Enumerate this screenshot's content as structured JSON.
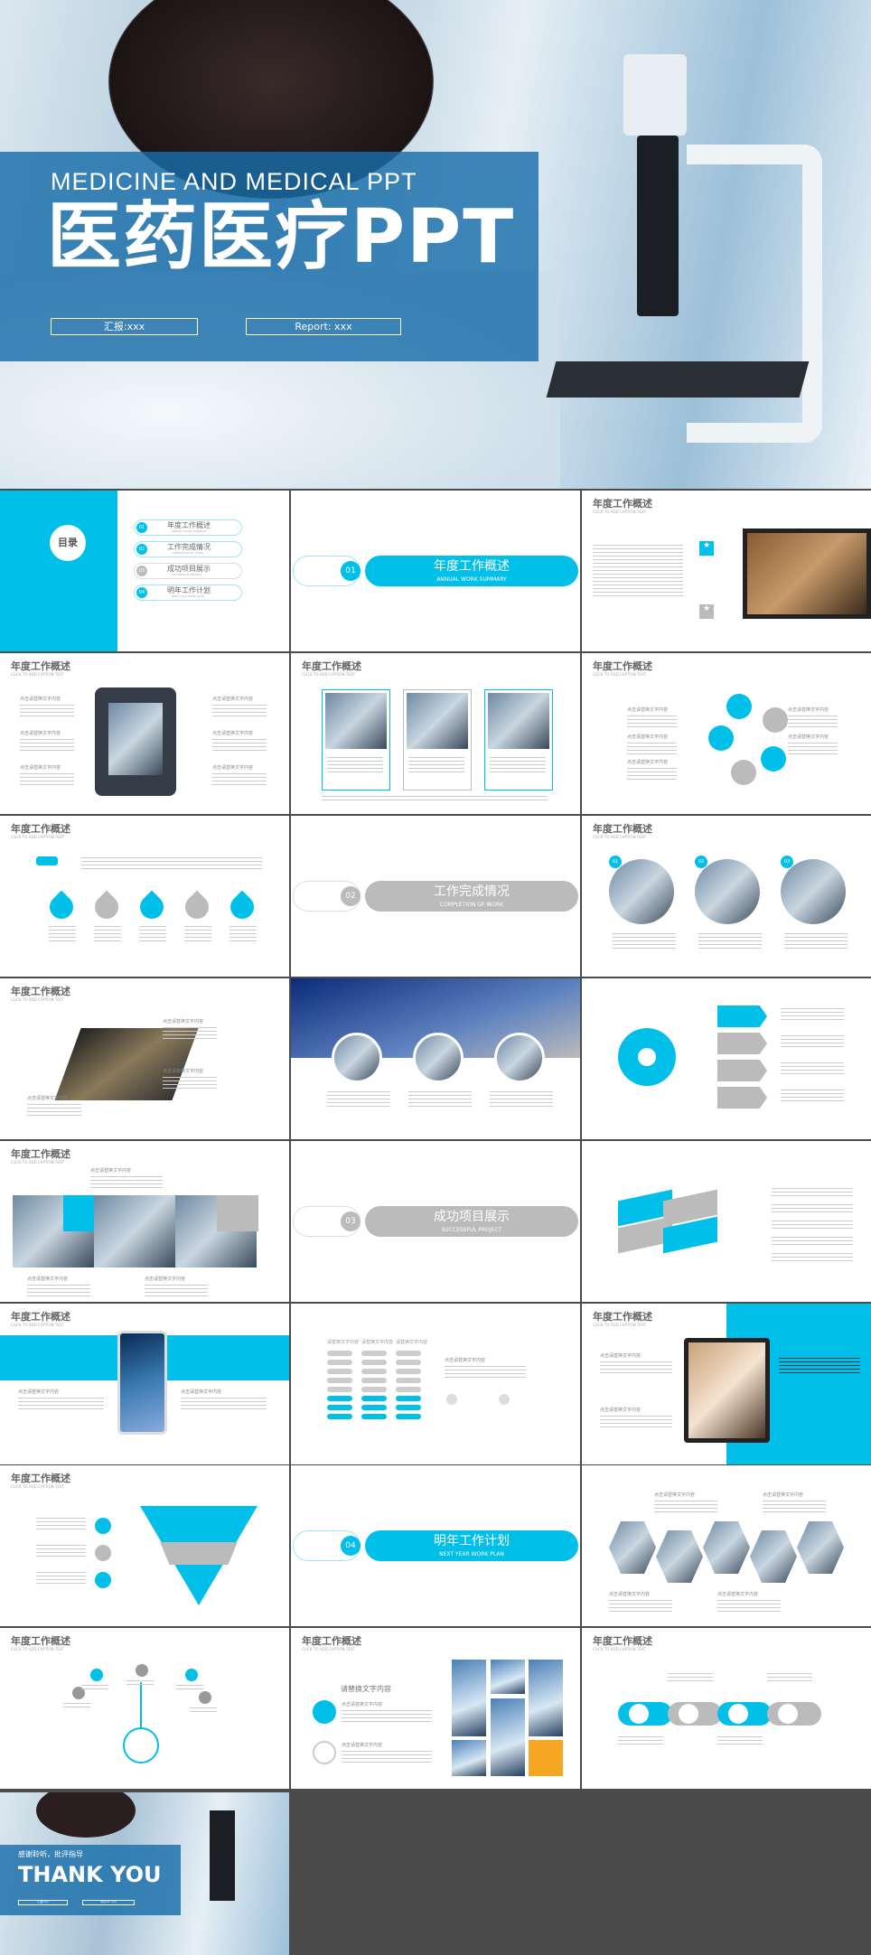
{
  "colors": {
    "accent": "#00bfe9",
    "gray": "#bbbbbb",
    "orange": "#f5a623",
    "band": "#196eaa",
    "background": "#4b4b4b"
  },
  "cover": {
    "en_title": "MEDICINE AND MEDICAL PPT",
    "cn_title": "医药医疗PPT",
    "reporter": "汇报:xxx",
    "report": "Report: xxx"
  },
  "common": {
    "slide_title": "年度工作概述",
    "caption": "CLICK TO ADD CAPTION TEXT",
    "placeholder": "点击请替换文字内容",
    "placeholder2": "请替换文字内容"
  },
  "toc": {
    "heading": "目录",
    "items": [
      {
        "num": "01",
        "label": "年度工作概述",
        "en": "ANNUAL WORK SUMMARY",
        "active": true
      },
      {
        "num": "02",
        "label": "工作完成情况",
        "en": "COMPLETION OF WORK",
        "active": true
      },
      {
        "num": "03",
        "label": "成功项目展示",
        "en": "SUCCESSFUL PROJECT",
        "active": false
      },
      {
        "num": "04",
        "label": "明年工作计划",
        "en": "NEXT YEAR WORK PLAN",
        "active": true
      }
    ]
  },
  "sections": [
    {
      "num": "01",
      "label": "年度工作概述",
      "en": "ANNUAL WORK SUMMARY",
      "color": "cyan"
    },
    {
      "num": "02",
      "label": "工作完成情况",
      "en": "COMPLETION OF WORK",
      "color": "gray"
    },
    {
      "num": "03",
      "label": "成功项目展示",
      "en": "SUCCESSFUL PROJECT",
      "color": "gray"
    },
    {
      "num": "04",
      "label": "明年工作计划",
      "en": "NEXT YEAR WORK PLAN",
      "color": "cyan"
    }
  ],
  "circle_numbers": [
    "01",
    "02",
    "03"
  ],
  "thanks": {
    "cn": "感谢聆听，批评指导",
    "en": "THANK YOU",
    "reporter": "汇报:xxx",
    "report": "Report: xxx"
  }
}
